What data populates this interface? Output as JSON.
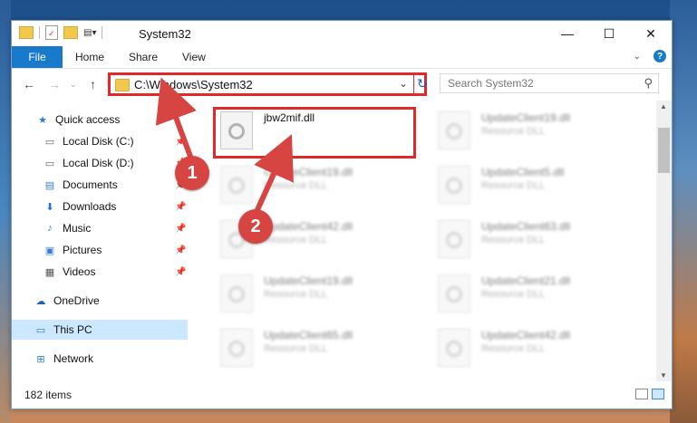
{
  "window": {
    "title": "System32",
    "controls": {
      "minimize": "—",
      "maximize": "☐",
      "close": "✕"
    }
  },
  "ribbon": {
    "tabs": [
      "File",
      "Home",
      "Share",
      "View"
    ]
  },
  "navigation": {
    "back": "←",
    "forward": "→",
    "up": "↑",
    "address": "C:\\Windows\\System32",
    "search_placeholder": "Search System32"
  },
  "sidebar": {
    "items": [
      {
        "label": "Quick access",
        "icon": "star-icon",
        "pinned": false
      },
      {
        "label": "Local Disk (C:)",
        "icon": "drive-icon",
        "pinned": true
      },
      {
        "label": "Local Disk (D:)",
        "icon": "drive-icon",
        "pinned": true
      },
      {
        "label": "Documents",
        "icon": "document-icon",
        "pinned": true
      },
      {
        "label": "Downloads",
        "icon": "download-icon",
        "pinned": true
      },
      {
        "label": "Music",
        "icon": "music-icon",
        "pinned": true
      },
      {
        "label": "Pictures",
        "icon": "picture-icon",
        "pinned": true
      },
      {
        "label": "Videos",
        "icon": "video-icon",
        "pinned": true
      },
      {
        "label": "OneDrive",
        "icon": "cloud-icon",
        "pinned": false
      },
      {
        "label": "This PC",
        "icon": "computer-icon",
        "pinned": false,
        "selected": true
      },
      {
        "label": "Network",
        "icon": "network-icon",
        "pinned": false
      }
    ]
  },
  "files": [
    {
      "name": "jbw2mif.dll",
      "type": ""
    },
    {
      "name": "UpdateClient19.dll",
      "type": "Resource DLL"
    },
    {
      "name": "UpdateClient19.dll",
      "type": "Resource DLL"
    },
    {
      "name": "UpdateClient5.dll",
      "type": "Resource DLL"
    },
    {
      "name": "UpdateClient42.dll",
      "type": "Resource DLL"
    },
    {
      "name": "UpdateClient63.dll",
      "type": "Resource DLL"
    },
    {
      "name": "UpdateClient19.dll",
      "type": "Resource DLL"
    },
    {
      "name": "UpdateClient21.dll",
      "type": "Resource DLL"
    },
    {
      "name": "UpdateClient65.dll",
      "type": "Resource DLL"
    },
    {
      "name": "UpdateClient42.dll",
      "type": "Resource DLL"
    }
  ],
  "status": {
    "item_count": "182 items"
  },
  "annotations": {
    "step1": "1",
    "step2": "2",
    "color": "#d64541"
  }
}
